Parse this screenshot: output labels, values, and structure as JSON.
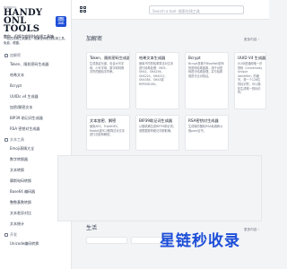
{
  "brand": {
    "small_top": "HANDY.cn",
    "name_line1": "HANDY ONL",
    "name_line2": "TOOLS",
    "subtitle": "教你，但努力你科技在线工具箱",
    "badge": "壹",
    "tagline": "一站式在线工具集合，收集全网在线实用工具，免费，便捷。"
  },
  "nav": [
    {
      "type": "group",
      "label": "加解密"
    },
    {
      "type": "item",
      "label": "Token、随机密码生成器"
    },
    {
      "type": "item",
      "label": "哈希文本"
    },
    {
      "type": "item",
      "label": "Bcrypt"
    },
    {
      "type": "item",
      "label": "UUIDs v4 生成器"
    },
    {
      "type": "item",
      "label": "加密/解密文本"
    },
    {
      "type": "item",
      "label": "BIP39 助记词生成器"
    },
    {
      "type": "item",
      "label": "RSA 密钥对生成器"
    },
    {
      "type": "group",
      "label": "文本工具"
    },
    {
      "type": "item",
      "label": "Emoji表情大全"
    },
    {
      "type": "item",
      "label": "数字转换器"
    },
    {
      "type": "item",
      "label": "文本转换"
    },
    {
      "type": "item",
      "label": "摩斯电码转换"
    },
    {
      "type": "item",
      "label": "Base64 编码器"
    },
    {
      "type": "item",
      "label": "整数基数转换"
    },
    {
      "type": "item",
      "label": "文本差异对比"
    },
    {
      "type": "item",
      "label": "文本统计"
    },
    {
      "type": "group",
      "label": "开发"
    },
    {
      "type": "item",
      "label": "Unicode编码转换"
    }
  ],
  "topbar": {
    "search_placeholder": "Search a tool: 搜索在线工具"
  },
  "sections": [
    {
      "title": "加解密",
      "more": "更多内容 ›"
    },
    {
      "title": "生活",
      "more": "更多内容 ›"
    }
  ],
  "cards": [
    {
      "title": "Token、随机密码生成器",
      "desc": "生成指定长度、包含大写字母、小写字母、数字和特殊字符的随机字符串。"
    },
    {
      "title": "哈希文本生成器",
      "desc": "使用不同的哈希算法对文本进行哈希处理：MD5、SHA1、SHA256、SHA224、SHA512、SHA384、SHA3或RIPEMD160。"
    },
    {
      "title": "Bcrypt",
      "desc": "Bcrypt是基于Blowfish密码的密码哈希函数，用于对密码进行哈希处理，并与哈希值进行比对验证。"
    },
    {
      "title": "UUID V4 生成器",
      "desc": "UUID是通用唯一识别码（Universally Unique Identifier）的缩写，是一个128位的标识符，可以随机生成唯一的标识符。"
    },
    {
      "title": "文本加密、解密",
      "desc": "使用AES、TripleDES、Rabbit或RC4等算法对文本进行加密和解密。"
    },
    {
      "title": "BIP39助记词生成器",
      "desc": "从随机熵生成BIP39助记词，或根据现有助记词获取熵。"
    },
    {
      "title": "RSA密钥对生成器",
      "desc": "生成新的随机RSA私钥和公钥pem证书。"
    }
  ],
  "watermark": "星链秒收录"
}
